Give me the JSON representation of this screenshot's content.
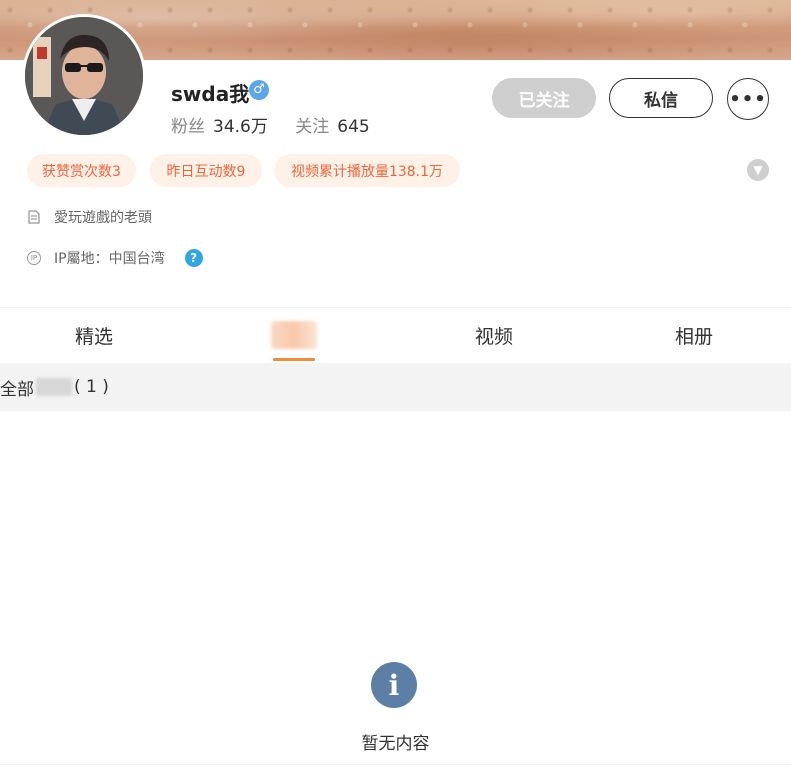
{
  "profile": {
    "name": "swda我",
    "gender_icon": "male-icon",
    "stats": [
      {
        "label": "粉丝",
        "value": "34.6万"
      },
      {
        "label": "关注",
        "value": "645"
      }
    ]
  },
  "actions": {
    "followed": "已关注",
    "message": "私信",
    "more": "•••"
  },
  "tags": [
    "获赞赏次数3",
    "昨日互动数9",
    "视频累计播放量138.1万"
  ],
  "bio": "愛玩遊戲的老頭",
  "ip": {
    "badge": "IP",
    "label": "IP屬地：中国台湾"
  },
  "tabs": [
    {
      "label": "精选"
    },
    {
      "label": ""
    },
    {
      "label": "视频"
    },
    {
      "label": "相册"
    }
  ],
  "filter": {
    "prefix": "全部",
    "count": "( 1 )"
  },
  "empty": {
    "text": "暂无内容",
    "icon": "info-icon"
  },
  "colors": {
    "accent": "#f38a34",
    "tag_bg": "#fff0e8",
    "tag_text": "#e8683b",
    "followed_bg": "#cfcfcf",
    "empty_icon": "#5d7fa6"
  }
}
